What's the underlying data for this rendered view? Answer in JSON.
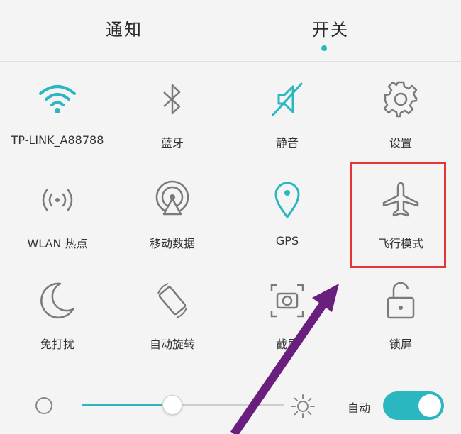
{
  "tabs": {
    "notify": "通知",
    "switches": "开关",
    "active": "switches"
  },
  "toggles": [
    {
      "id": "wifi",
      "label": "TP-LINK_A88788",
      "icon": "wifi-icon",
      "active": true
    },
    {
      "id": "bluetooth",
      "label": "蓝牙",
      "icon": "bluetooth-icon",
      "active": false
    },
    {
      "id": "mute",
      "label": "静音",
      "icon": "mute-icon",
      "active": true
    },
    {
      "id": "settings",
      "label": "设置",
      "icon": "gear-icon",
      "active": false
    },
    {
      "id": "hotspot",
      "label": "WLAN 热点",
      "icon": "hotspot-icon",
      "active": false
    },
    {
      "id": "mobile-data",
      "label": "移动数据",
      "icon": "mobile-data-icon",
      "active": false
    },
    {
      "id": "gps",
      "label": "GPS",
      "icon": "location-pin-icon",
      "active": true
    },
    {
      "id": "airplane",
      "label": "飞行模式",
      "icon": "airplane-icon",
      "active": false
    },
    {
      "id": "dnd",
      "label": "免打扰",
      "icon": "moon-icon",
      "active": false
    },
    {
      "id": "rotate",
      "label": "自动旋转",
      "icon": "rotate-icon",
      "active": false
    },
    {
      "id": "screenshot",
      "label": "截屏",
      "icon": "camera-icon",
      "active": false
    },
    {
      "id": "lock",
      "label": "锁屏",
      "icon": "unlock-icon",
      "active": false
    }
  ],
  "brightness": {
    "level": 0.45,
    "auto_label": "自动",
    "auto": true
  },
  "colors": {
    "accent": "#2ab7c0",
    "highlight": "#e53535",
    "arrow": "#6a1e7e"
  }
}
